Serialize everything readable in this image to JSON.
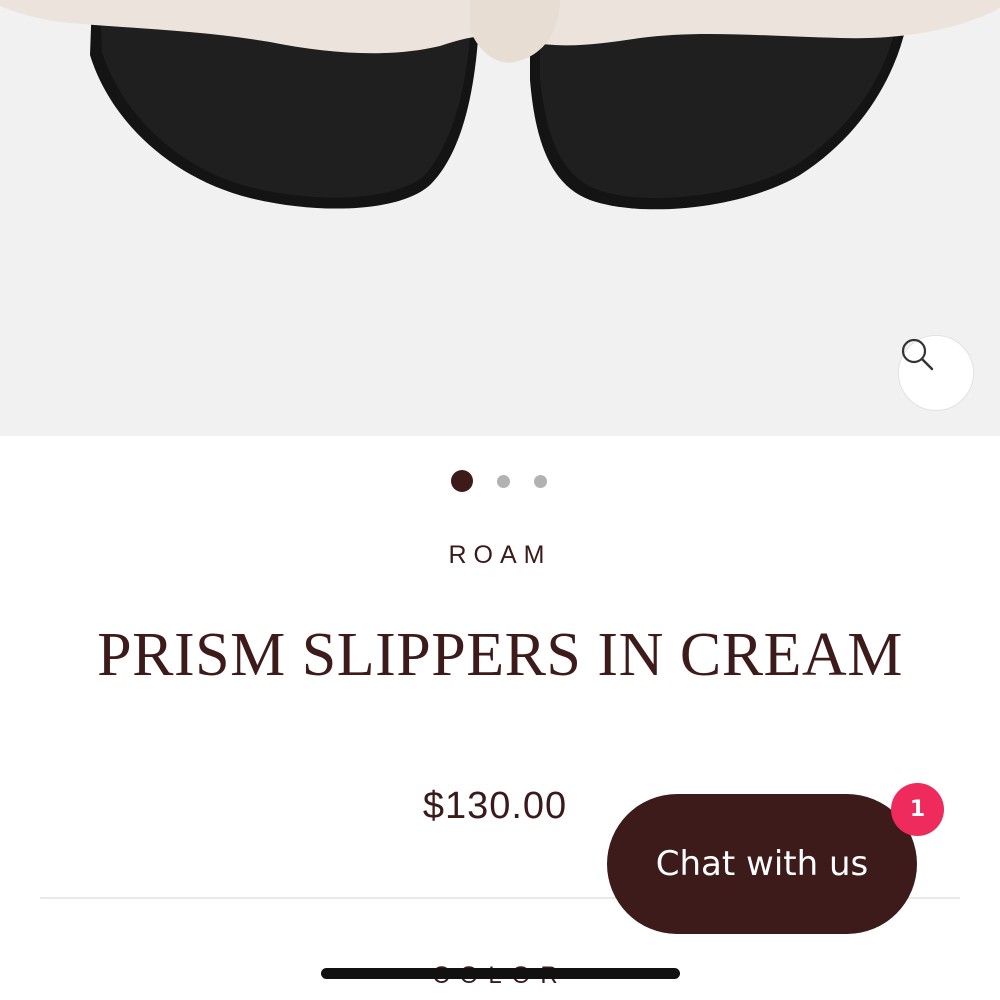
{
  "product": {
    "brand": "ROAM",
    "title": "PRISM SLIPPERS IN CREAM",
    "price": "$130.00",
    "option_label": "COLOR",
    "image_gallery": {
      "count": 3,
      "active_index": 0
    }
  },
  "icons": {
    "zoom": "magnifier-icon"
  },
  "chat": {
    "label": "Chat with us",
    "badge_count": "1"
  },
  "colors": {
    "brand_dark": "#3d1b1b",
    "badge": "#ef2a5c",
    "hero_background": "#f1f1f1",
    "dot_inactive": "#b3b1b1"
  }
}
